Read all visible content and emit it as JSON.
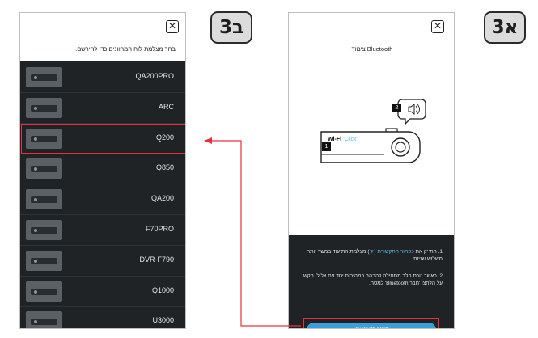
{
  "badges": {
    "left": "3ב",
    "right": "3א"
  },
  "left_screen": {
    "hint": "בחר מצלמת לוח המחוונים כדי להירשם.",
    "models": [
      "QA200PRO",
      "ARC",
      "Q200",
      "Q850",
      "QA200",
      "F70PRO",
      "DVR-F790",
      "Q1000",
      "U3000"
    ],
    "selected_model": "Q200"
  },
  "right_screen": {
    "title": "צימוד Bluetooth",
    "illustration": {
      "wifi_label": "Wi-Fi",
      "click_label": "'Click'",
      "step1": "1",
      "step2": "2"
    },
    "instruction1_a": "1. התייק את ",
    "instruction1_hl": "כפתור התקשורת (",
    "instruction1_b": ") מצלמת התיעוד במשך יותר משלוש שניות.",
    "instruction2": "2. כאשר נורת הלד מתחילה להבהב במהירות יחד עם צליל, הקש על הלחצן 'חבר Bluetooth' למטה.",
    "connect_button": "חיבור Bluetooth"
  },
  "colors": {
    "highlight": "#e5303d",
    "accent": "#3a9fd8",
    "panel": "#1f2325"
  }
}
